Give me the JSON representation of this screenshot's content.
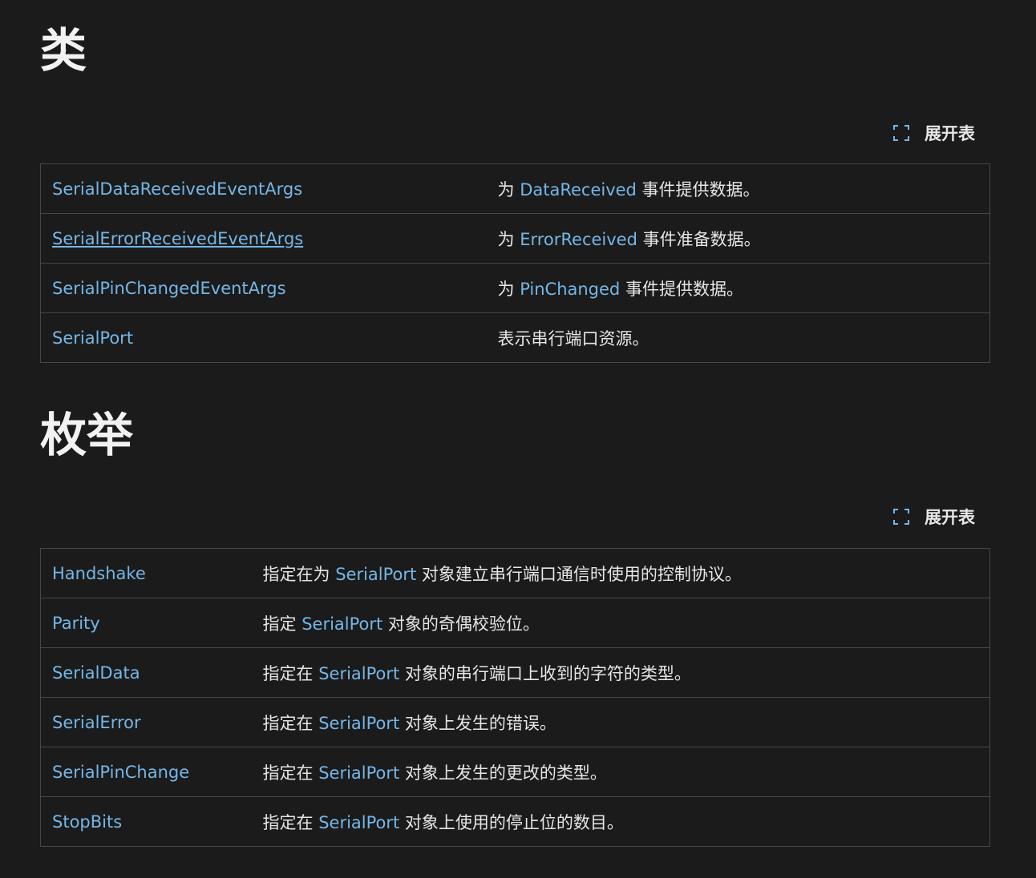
{
  "classes": {
    "heading": "类",
    "expand_label": "展开表",
    "rows": [
      {
        "name": "SerialDataReceivedEventArgs",
        "pre": "为 ",
        "link": "DataReceived",
        "post": " 事件提供数据。"
      },
      {
        "name": "SerialErrorReceivedEventArgs",
        "pre": "为 ",
        "link": "ErrorReceived",
        "post": " 事件准备数据。"
      },
      {
        "name": "SerialPinChangedEventArgs",
        "pre": "为 ",
        "link": "PinChanged",
        "post": " 事件提供数据。"
      },
      {
        "name": "SerialPort",
        "pre": "表示串行端口资源。",
        "link": "",
        "post": ""
      }
    ]
  },
  "enums": {
    "heading": "枚举",
    "expand_label": "展开表",
    "rows": [
      {
        "name": "Handshake",
        "pre": "指定在为 ",
        "link": "SerialPort",
        "post": " 对象建立串行端口通信时使用的控制协议。"
      },
      {
        "name": "Parity",
        "pre": "指定 ",
        "link": "SerialPort",
        "post": " 对象的奇偶校验位。"
      },
      {
        "name": "SerialData",
        "pre": "指定在 ",
        "link": "SerialPort",
        "post": " 对象的串行端口上收到的字符的类型。"
      },
      {
        "name": "SerialError",
        "pre": "指定在 ",
        "link": "SerialPort",
        "post": " 对象上发生的错误。"
      },
      {
        "name": "SerialPinChange",
        "pre": "指定在 ",
        "link": "SerialPort",
        "post": " 对象上发生的更改的类型。"
      },
      {
        "name": "StopBits",
        "pre": "指定在 ",
        "link": "SerialPort",
        "post": " 对象上使用的停止位的数目。"
      }
    ]
  },
  "colors": {
    "background": "#1b1b1b",
    "link": "#75b6e7",
    "border": "#474747",
    "text": "#e6e6e6"
  }
}
